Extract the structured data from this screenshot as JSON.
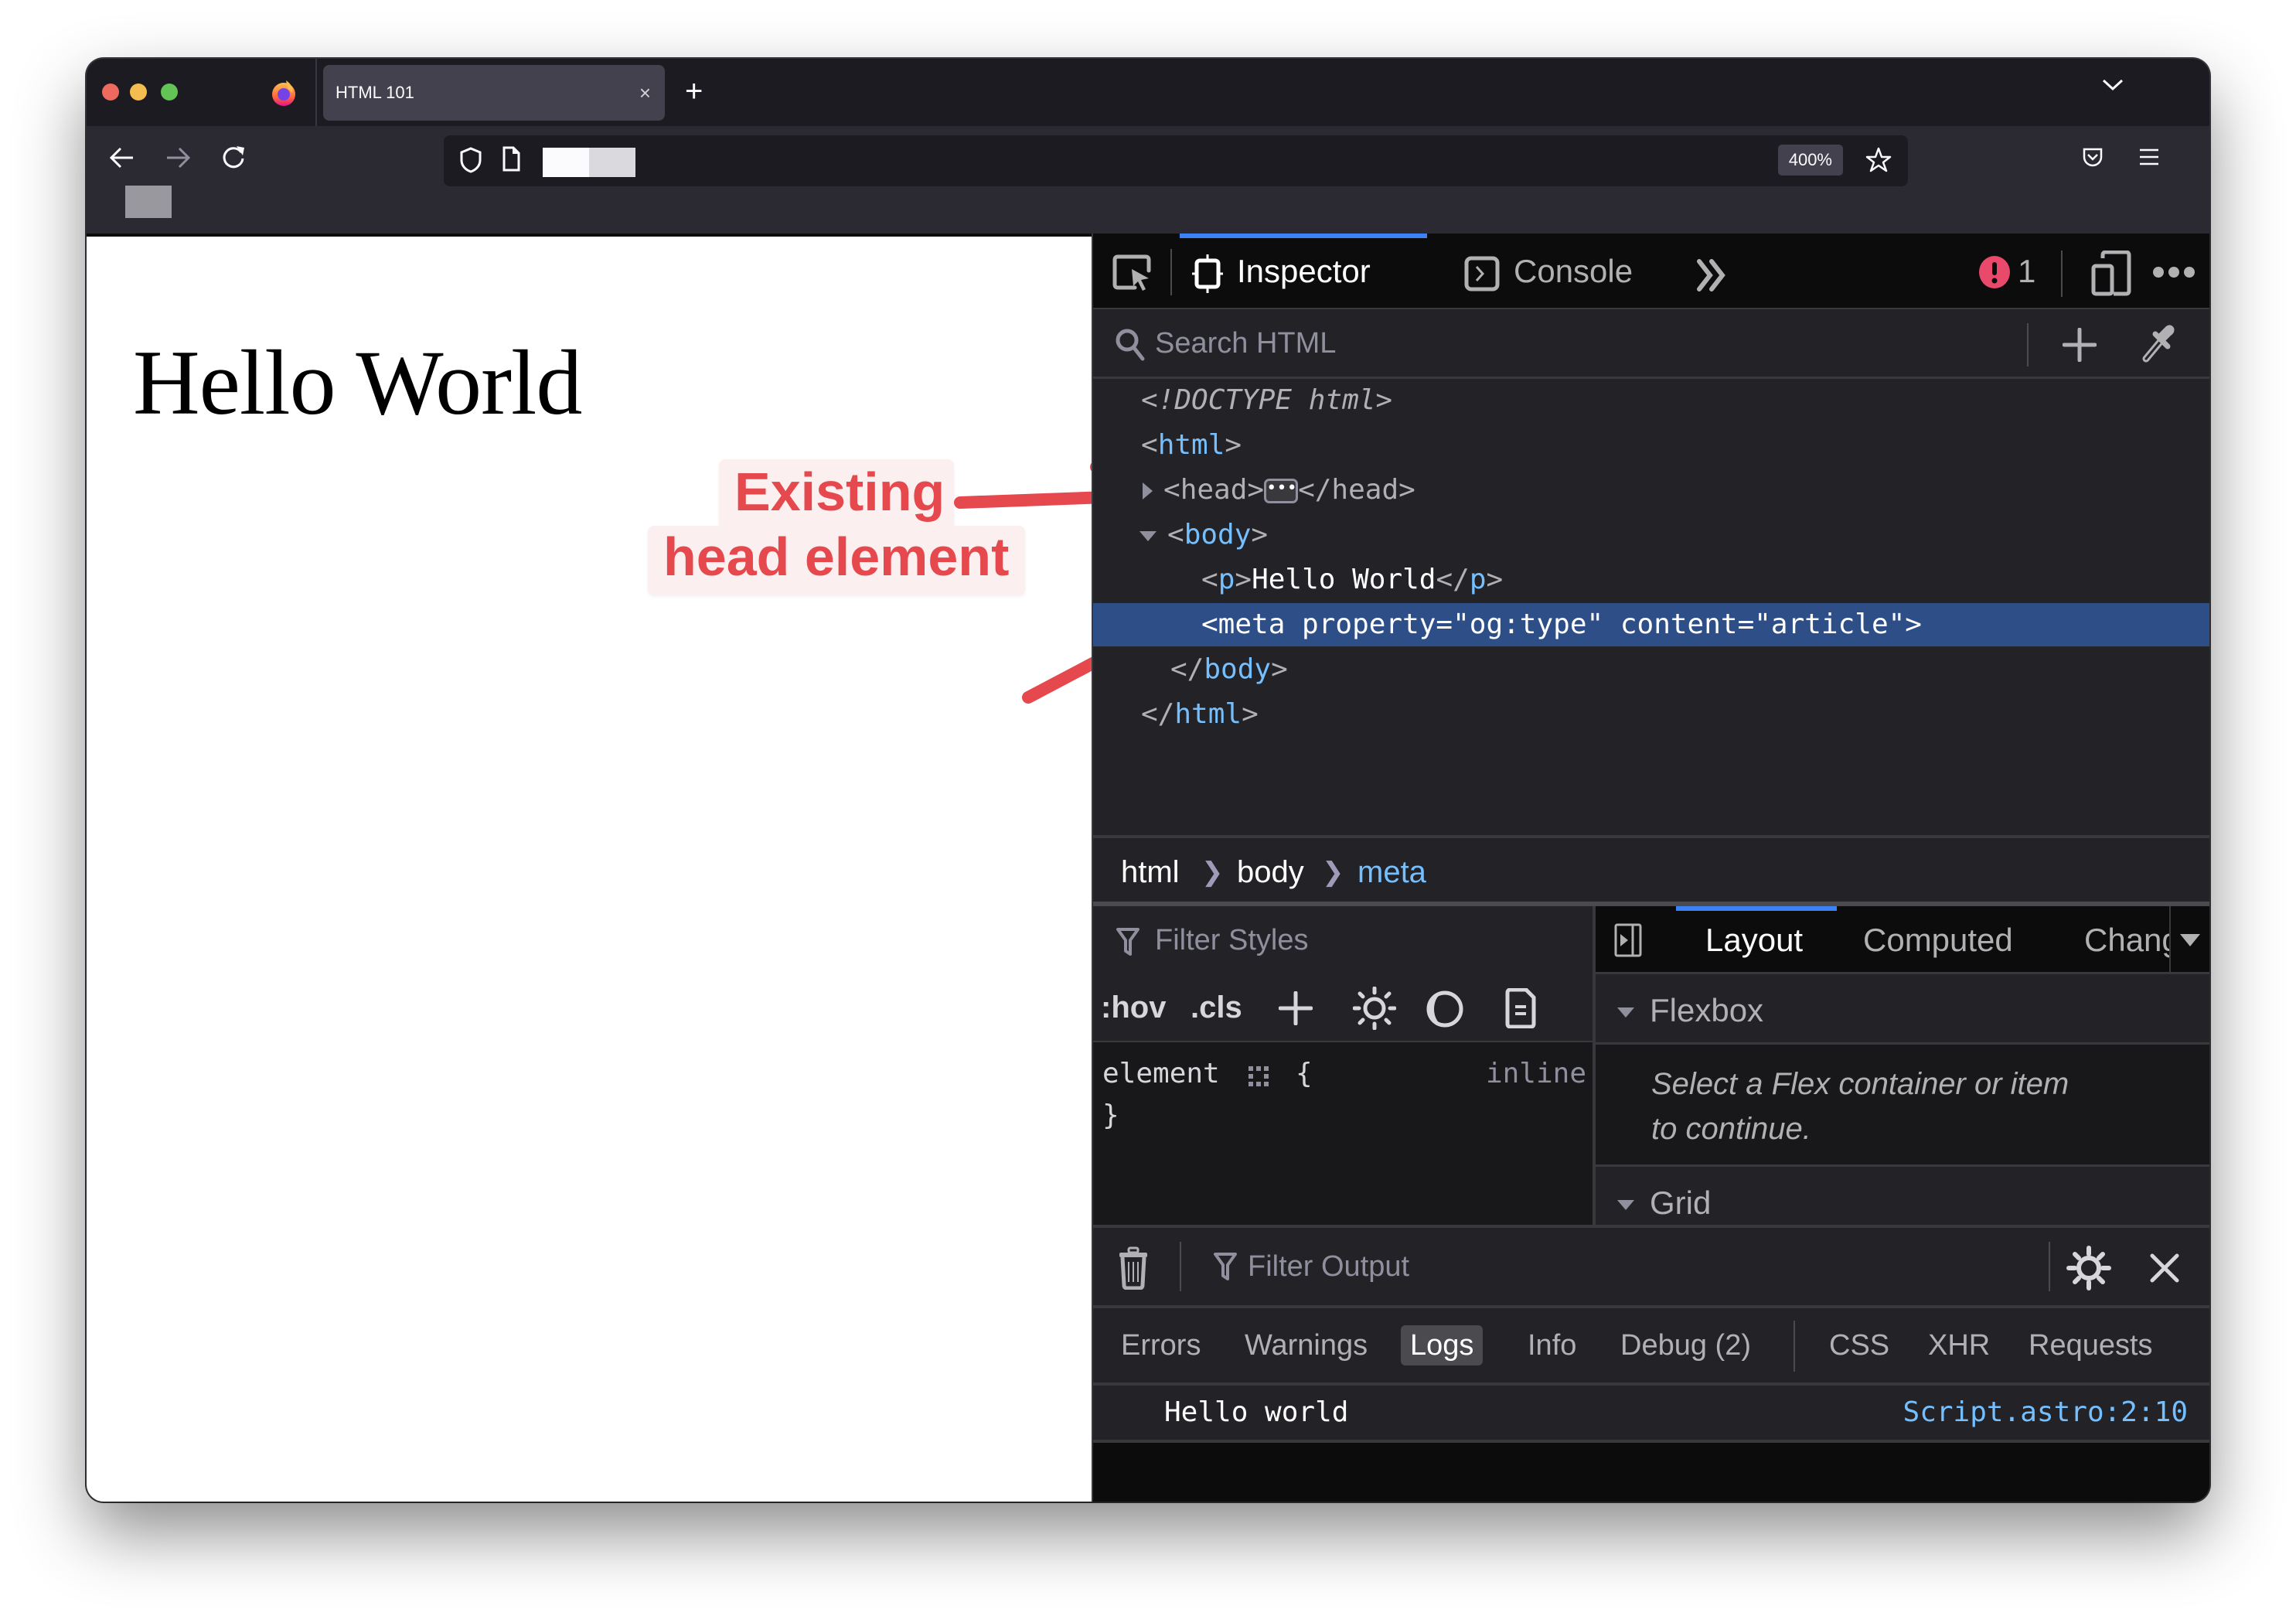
{
  "browser": {
    "tab_title": "HTML 101",
    "tab_close": "×",
    "new_tab": "+",
    "zoom_level": "400%",
    "url_redacted": true,
    "traffic_colors": {
      "close": "#ee6a5f",
      "minimize": "#f5bd4f",
      "maximize": "#61c454"
    }
  },
  "page": {
    "heading": "Hello World"
  },
  "annotation": {
    "line1": "Existing",
    "line2": "head element",
    "color": "#e5484d"
  },
  "devtools": {
    "tabs": [
      {
        "label": "Inspector",
        "active": true
      },
      {
        "label": "Console",
        "active": false
      }
    ],
    "more_tabs": "»",
    "error_count": "1",
    "search_placeholder": "Search HTML",
    "markup": {
      "doctype": "<!DOCTYPE html>",
      "lines": [
        {
          "open": "<",
          "tag": "html",
          "close": ">"
        },
        {
          "open": "<",
          "tag": "head",
          "close": ">",
          "collapsed": true,
          "end": "</head>"
        },
        {
          "open": "<",
          "tag": "body",
          "close": ">"
        },
        {
          "open": "<",
          "tag": "p",
          "close": ">",
          "text": "Hello World",
          "end_open": "</",
          "end_tag": "p",
          "end_close": ">"
        },
        {
          "text": "<meta property=\"og:type\" content=\"article\">",
          "selected": true
        },
        {
          "open": "</",
          "tag": "body",
          "close": ">"
        },
        {
          "open": "</",
          "tag": "html",
          "close": ">"
        }
      ]
    },
    "breadcrumb": [
      "html",
      "body",
      "meta"
    ],
    "styles": {
      "filter_placeholder": "Filter Styles",
      "hov": ":hov",
      "cls": ".cls",
      "rule_selector": "element",
      "rule_open": "{",
      "rule_close": "}",
      "rule_source": "inline"
    },
    "layout": {
      "tabs": [
        {
          "label": "Layout",
          "active": true
        },
        {
          "label": "Computed",
          "active": false
        },
        {
          "label": "Chang",
          "active": false
        }
      ],
      "flexbox_label": "Flexbox",
      "flex_message_line1": "Select a Flex container or item",
      "flex_message_line2": "to continue.",
      "grid_label": "Grid"
    },
    "console": {
      "filter_placeholder": "Filter Output",
      "filters": [
        {
          "label": "Errors",
          "active": false
        },
        {
          "label": "Warnings",
          "active": false
        },
        {
          "label": "Logs",
          "active": true
        },
        {
          "label": "Info",
          "active": false
        },
        {
          "label": "Debug (2)",
          "active": false
        },
        {
          "label": "CSS",
          "active": false
        },
        {
          "label": "XHR",
          "active": false
        },
        {
          "label": "Requests",
          "active": false
        }
      ],
      "log_message": "Hello world",
      "log_source": "Script.astro:2:10"
    },
    "colors": {
      "accent": "#3b82f6",
      "selection": "#2d4e86",
      "tag": "#75bfff",
      "error": "#e9496b"
    }
  }
}
